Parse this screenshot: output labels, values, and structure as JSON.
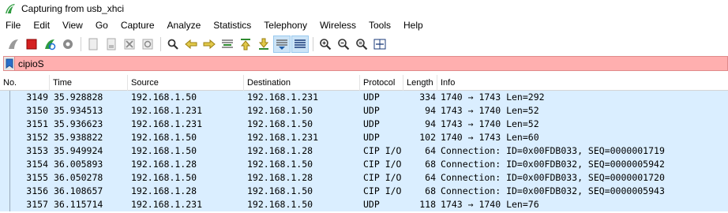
{
  "window": {
    "title": "Capturing from usb_xhci"
  },
  "menu": [
    "File",
    "Edit",
    "View",
    "Go",
    "Capture",
    "Analyze",
    "Statistics",
    "Telephony",
    "Wireless",
    "Tools",
    "Help"
  ],
  "toolbar": {
    "icons": [
      "start-capture-icon",
      "stop-capture-icon",
      "restart-capture-icon",
      "capture-options-icon",
      "open-file-icon",
      "save-file-icon",
      "close-file-icon",
      "reload-file-icon",
      "find-packet-icon",
      "go-back-icon",
      "go-forward-icon",
      "go-to-packet-icon",
      "go-first-icon",
      "go-last-icon",
      "auto-scroll-icon",
      "colorize-icon",
      "zoom-in-icon",
      "zoom-out-icon",
      "zoom-normal-icon",
      "resize-columns-icon"
    ]
  },
  "filter": {
    "value": "cipioS"
  },
  "columns": [
    "No.",
    "Time",
    "Source",
    "Destination",
    "Protocol",
    "Length",
    "Info"
  ],
  "packets": [
    {
      "no": "3149",
      "time": "35.928828",
      "src": "192.168.1.50",
      "dst": "192.168.1.231",
      "proto": "UDP",
      "len": "334",
      "info": "1740 → 1743 Len=292"
    },
    {
      "no": "3150",
      "time": "35.934513",
      "src": "192.168.1.231",
      "dst": "192.168.1.50",
      "proto": "UDP",
      "len": "94",
      "info": "1743 → 1740 Len=52"
    },
    {
      "no": "3151",
      "time": "35.936623",
      "src": "192.168.1.231",
      "dst": "192.168.1.50",
      "proto": "UDP",
      "len": "94",
      "info": "1743 → 1740 Len=52"
    },
    {
      "no": "3152",
      "time": "35.938822",
      "src": "192.168.1.50",
      "dst": "192.168.1.231",
      "proto": "UDP",
      "len": "102",
      "info": "1740 → 1743 Len=60"
    },
    {
      "no": "3153",
      "time": "35.949924",
      "src": "192.168.1.50",
      "dst": "192.168.1.28",
      "proto": "CIP I/O",
      "len": "64",
      "info": "Connection: ID=0x00FDB033, SEQ=0000001719"
    },
    {
      "no": "3154",
      "time": "36.005893",
      "src": "192.168.1.28",
      "dst": "192.168.1.50",
      "proto": "CIP I/O",
      "len": "68",
      "info": "Connection: ID=0x00FDB032, SEQ=0000005942"
    },
    {
      "no": "3155",
      "time": "36.050278",
      "src": "192.168.1.50",
      "dst": "192.168.1.28",
      "proto": "CIP I/O",
      "len": "64",
      "info": "Connection: ID=0x00FDB033, SEQ=0000001720"
    },
    {
      "no": "3156",
      "time": "36.108657",
      "src": "192.168.1.28",
      "dst": "192.168.1.50",
      "proto": "CIP I/O",
      "len": "68",
      "info": "Connection: ID=0x00FDB032, SEQ=0000005943"
    },
    {
      "no": "3157",
      "time": "36.115714",
      "src": "192.168.1.231",
      "dst": "192.168.1.50",
      "proto": "UDP",
      "len": "118",
      "info": "1743 → 1740 Len=76"
    }
  ],
  "colors": {
    "filter_invalid": "#ffafaf",
    "udp_row": "#daeeff"
  }
}
